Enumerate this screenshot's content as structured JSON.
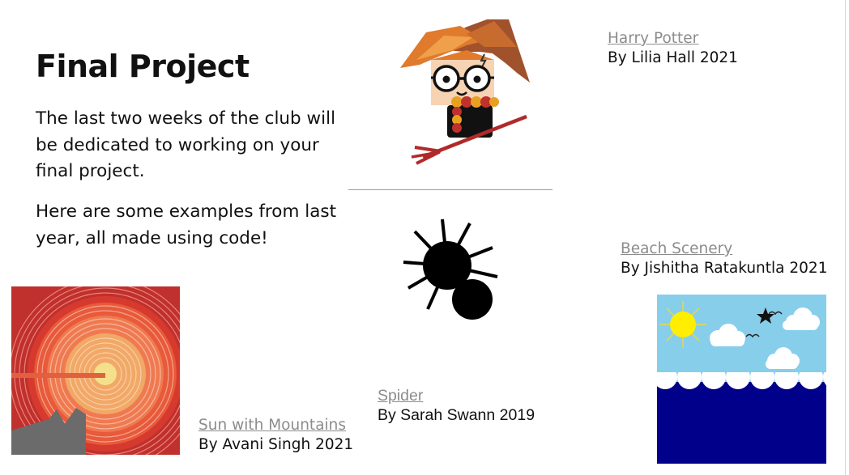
{
  "page": {
    "title": "Final Project",
    "paragraph_1": "The last two weeks of the club will be dedicated to working on your final project.",
    "paragraph_2": "Here are some examples from last year, all made using code!"
  },
  "projects": [
    {
      "name": "Harry Potter",
      "byline": "By Lilia Hall 2021"
    },
    {
      "name": "Beach Scenery",
      "byline": "By Jishitha Ratakuntla 2021"
    },
    {
      "name": "Spider",
      "byline": "By Sarah Swann 2019"
    },
    {
      "name": "Sun with Mountains",
      "byline": "By Avani Singh 2021"
    }
  ],
  "colors": {
    "link": "#8c8c8c",
    "text": "#111111",
    "sky": "#87ceeb",
    "ocean": "#00008b",
    "sun_red": "#c0302c"
  }
}
